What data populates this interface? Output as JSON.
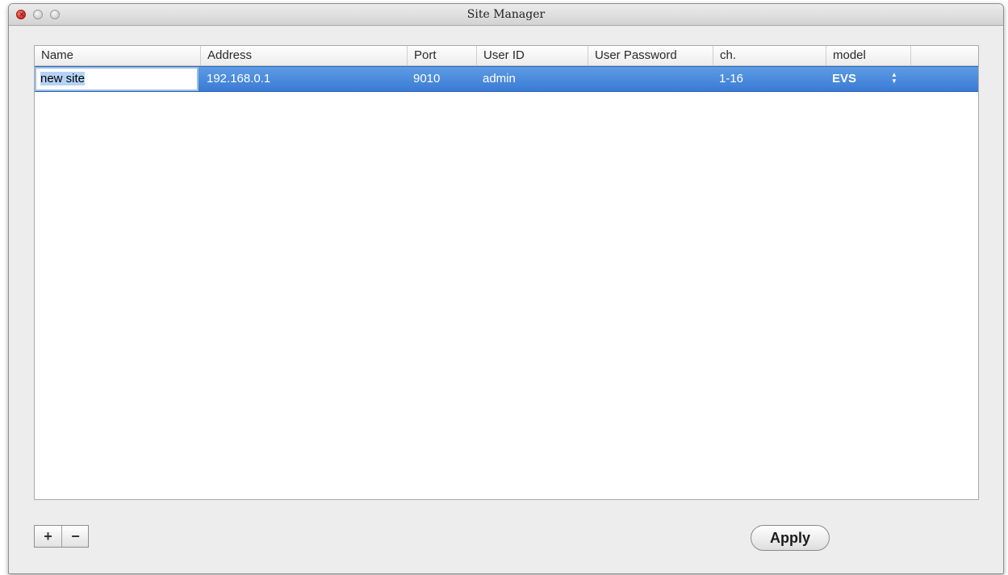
{
  "window": {
    "title": "Site Manager",
    "close_glyph": "✕"
  },
  "table": {
    "columns": [
      "Name",
      "Address",
      "Port",
      "User ID",
      "User Password",
      "ch.",
      "model"
    ],
    "rows": [
      {
        "name": "new site",
        "address": "192.168.0.1",
        "port": "9010",
        "user_id": "admin",
        "user_password": "",
        "ch": "1-16",
        "model": "EVS"
      }
    ],
    "selection_color": "#3a7bd5",
    "stepper_icon": "up-down-arrows-icon"
  },
  "footer": {
    "add_label": "+",
    "remove_label": "−",
    "apply_label": "Apply"
  }
}
